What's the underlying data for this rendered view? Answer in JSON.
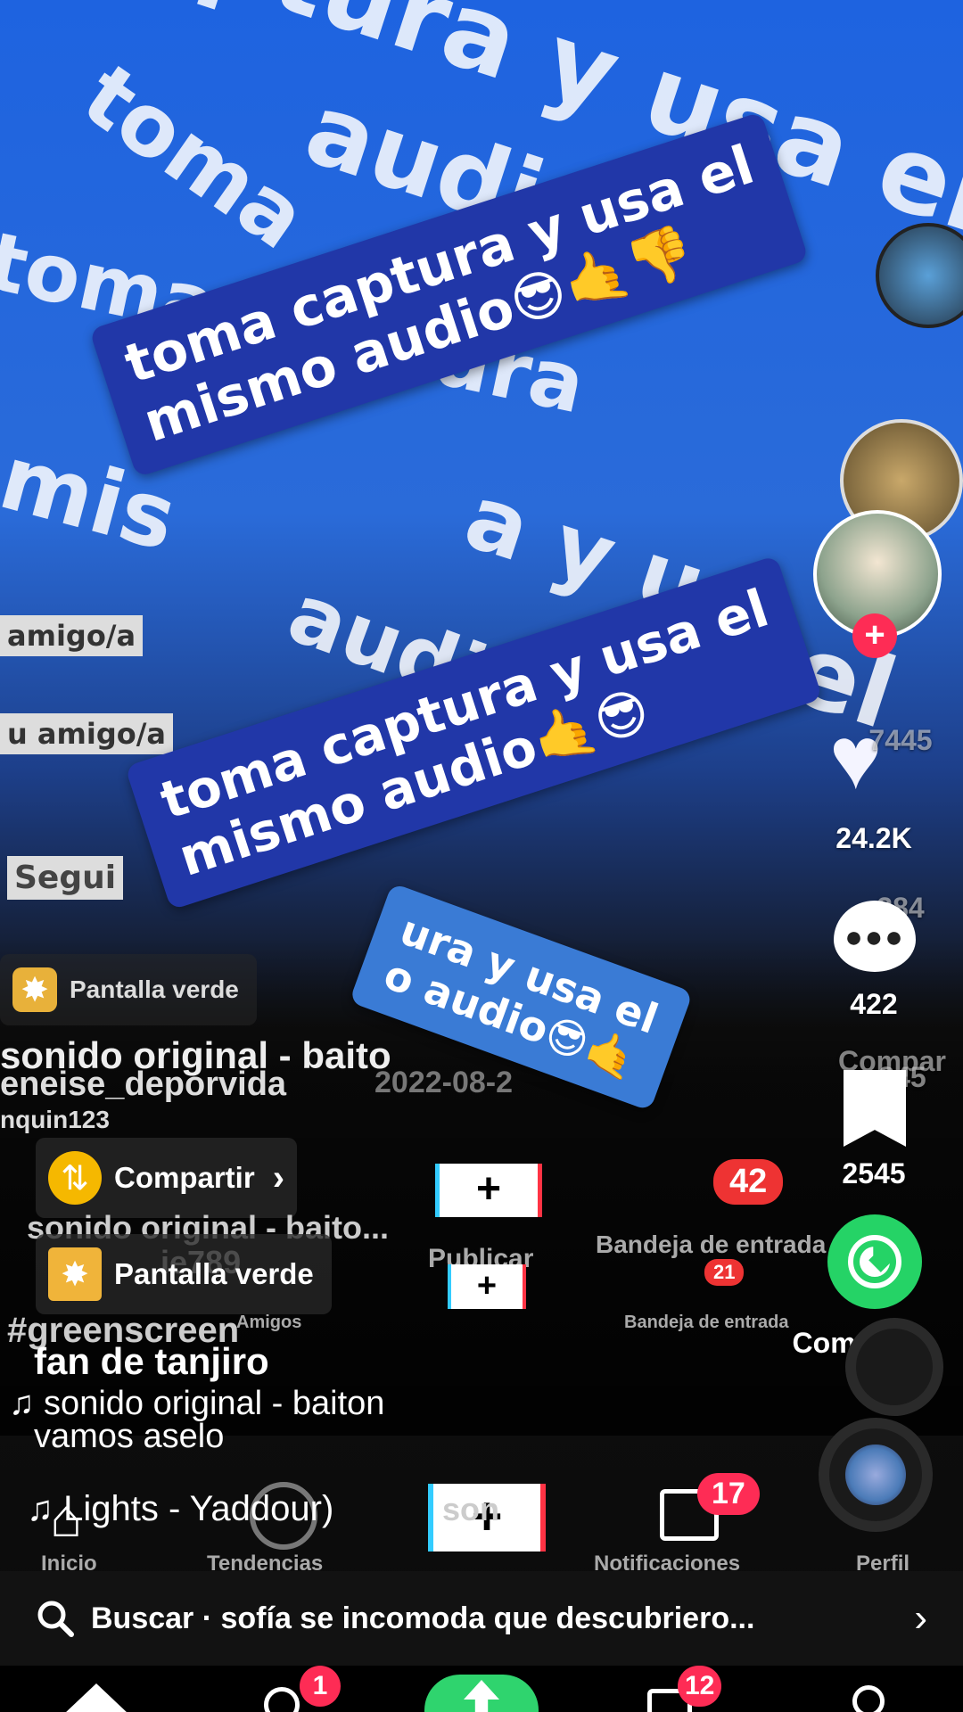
{
  "video": {
    "bg_lines": [
      "mi  ptura y usa el",
      "toma",
      "audio",
      "toma captura",
      "mis",
      "a y u",
      "audio",
      "el"
    ],
    "caption_top": [
      "toma captura y usa el",
      "mismo audio😎🤙👎"
    ],
    "caption_main": [
      "toma captura y usa el",
      "mismo audio🤙😎"
    ],
    "caption_lower": [
      "ura y usa el",
      "o audio😎🤙"
    ],
    "ghost_left": [
      "amigo/a",
      "u amigo/a",
      "Segui"
    ],
    "ghost_nav": {
      "compartir_badge": "42",
      "inbox_label": "Bandeja de entrada",
      "friends_label": "Amigos",
      "inicio_label": "Inicio",
      "inbox_small_badge": "21",
      "inbox_small_label": "Bandeja de entrada",
      "nav_labels": [
        "Inicio",
        "Tendencias",
        "Notificaciones",
        "Perfil"
      ],
      "notif_badge": "17",
      "overlay_texts": [
        "eneise_deporvida",
        "nquin123",
        "ie789",
        "Publicar",
        "2022-08-2",
        "son"
      ]
    }
  },
  "right_bar": {
    "follow_plus": "+",
    "like_count": "24.2K",
    "like_ghost": "7445",
    "comment_count": "422",
    "comment_ghost": "284",
    "bookmark_count": "2545",
    "bookmark_ghost": "845",
    "share_label": "Compartir",
    "compartir_ghost": "Compar"
  },
  "info": {
    "chip_green_label": "Pantalla verde",
    "chip_share_label": "Compartir",
    "chip_share_chev": "›",
    "chip_effect_label": "Pantalla verde",
    "sound_overlay": "sonido original - baito",
    "sound_overlay2": "sonido original - baito...",
    "hashtag": "#greenscreen",
    "username": "fan de tanjiro",
    "sound_label": "♫ sonido original - baiton",
    "description": "vamos aselo",
    "song2": "♫ Lights - Yaddour)"
  },
  "search": {
    "icon": "search-icon",
    "text": "Buscar · sofía se incomoda que descubriero...",
    "chevron": "›"
  },
  "nav": {
    "friends_badge": "1",
    "inbox_badge": "12"
  },
  "colors": {
    "caption_bg": "#2137a8",
    "accent_red": "#fe2c55",
    "whatsapp": "#25d366",
    "upload_green": "#2fd46e"
  }
}
